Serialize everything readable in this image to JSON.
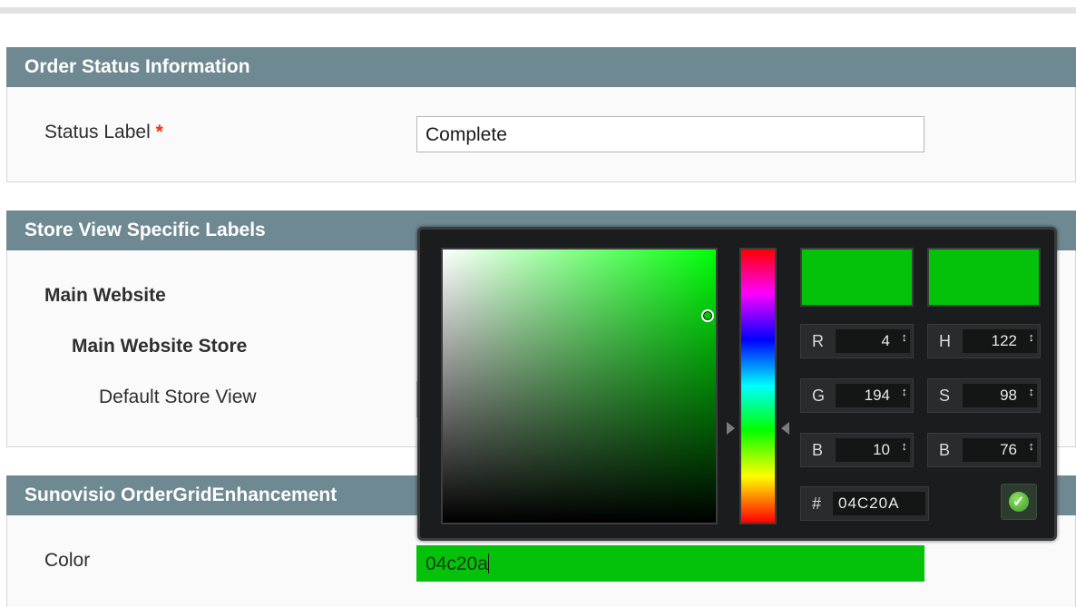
{
  "sections": {
    "order_status": {
      "title": "Order Status Information",
      "status_label": "Status Label",
      "required_mark": "*",
      "status_value": "Complete"
    },
    "store_view": {
      "title": "Store View Specific Labels",
      "website": "Main Website",
      "store": "Main Website Store",
      "view": "Default Store View"
    },
    "grid": {
      "title": "Sunovisio OrderGridEnhancement",
      "color_label": "Color",
      "color_value": "04c20a"
    }
  },
  "color_picker": {
    "current_color": "#04c20a",
    "rgb": [
      {
        "label": "R",
        "value": "4"
      },
      {
        "label": "G",
        "value": "194"
      },
      {
        "label": "B",
        "value": "10"
      }
    ],
    "hsb": [
      {
        "label": "H",
        "value": "122"
      },
      {
        "label": "S",
        "value": "98"
      },
      {
        "label": "B",
        "value": "76"
      }
    ],
    "hex_label": "#",
    "hex_value": "04C20A",
    "spinner_glyph": "↕",
    "submit_icon": "checkmark-icon"
  }
}
